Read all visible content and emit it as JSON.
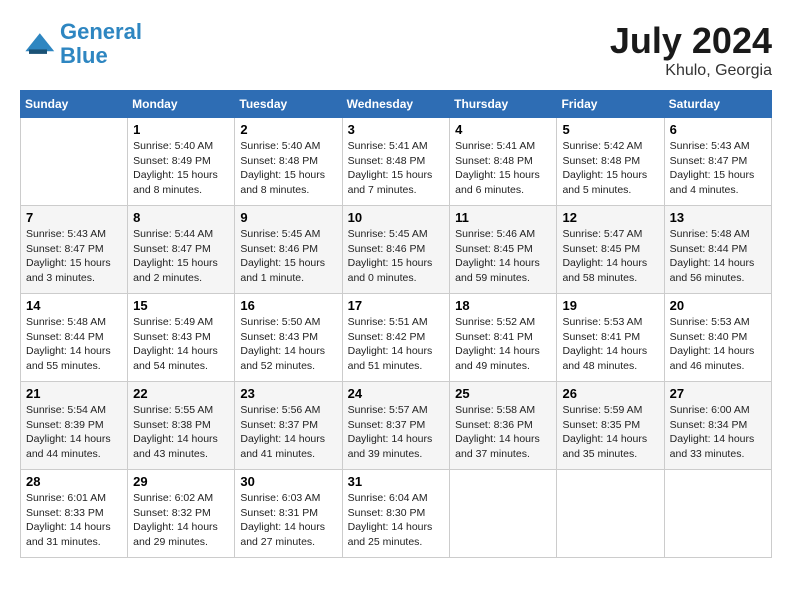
{
  "header": {
    "logo_line1": "General",
    "logo_line2": "Blue",
    "month": "July 2024",
    "location": "Khulo, Georgia"
  },
  "weekdays": [
    "Sunday",
    "Monday",
    "Tuesday",
    "Wednesday",
    "Thursday",
    "Friday",
    "Saturday"
  ],
  "weeks": [
    [
      {
        "day": "",
        "info": ""
      },
      {
        "day": "1",
        "info": "Sunrise: 5:40 AM\nSunset: 8:49 PM\nDaylight: 15 hours\nand 8 minutes."
      },
      {
        "day": "2",
        "info": "Sunrise: 5:40 AM\nSunset: 8:48 PM\nDaylight: 15 hours\nand 8 minutes."
      },
      {
        "day": "3",
        "info": "Sunrise: 5:41 AM\nSunset: 8:48 PM\nDaylight: 15 hours\nand 7 minutes."
      },
      {
        "day": "4",
        "info": "Sunrise: 5:41 AM\nSunset: 8:48 PM\nDaylight: 15 hours\nand 6 minutes."
      },
      {
        "day": "5",
        "info": "Sunrise: 5:42 AM\nSunset: 8:48 PM\nDaylight: 15 hours\nand 5 minutes."
      },
      {
        "day": "6",
        "info": "Sunrise: 5:43 AM\nSunset: 8:47 PM\nDaylight: 15 hours\nand 4 minutes."
      }
    ],
    [
      {
        "day": "7",
        "info": "Sunrise: 5:43 AM\nSunset: 8:47 PM\nDaylight: 15 hours\nand 3 minutes."
      },
      {
        "day": "8",
        "info": "Sunrise: 5:44 AM\nSunset: 8:47 PM\nDaylight: 15 hours\nand 2 minutes."
      },
      {
        "day": "9",
        "info": "Sunrise: 5:45 AM\nSunset: 8:46 PM\nDaylight: 15 hours\nand 1 minute."
      },
      {
        "day": "10",
        "info": "Sunrise: 5:45 AM\nSunset: 8:46 PM\nDaylight: 15 hours\nand 0 minutes."
      },
      {
        "day": "11",
        "info": "Sunrise: 5:46 AM\nSunset: 8:45 PM\nDaylight: 14 hours\nand 59 minutes."
      },
      {
        "day": "12",
        "info": "Sunrise: 5:47 AM\nSunset: 8:45 PM\nDaylight: 14 hours\nand 58 minutes."
      },
      {
        "day": "13",
        "info": "Sunrise: 5:48 AM\nSunset: 8:44 PM\nDaylight: 14 hours\nand 56 minutes."
      }
    ],
    [
      {
        "day": "14",
        "info": "Sunrise: 5:48 AM\nSunset: 8:44 PM\nDaylight: 14 hours\nand 55 minutes."
      },
      {
        "day": "15",
        "info": "Sunrise: 5:49 AM\nSunset: 8:43 PM\nDaylight: 14 hours\nand 54 minutes."
      },
      {
        "day": "16",
        "info": "Sunrise: 5:50 AM\nSunset: 8:43 PM\nDaylight: 14 hours\nand 52 minutes."
      },
      {
        "day": "17",
        "info": "Sunrise: 5:51 AM\nSunset: 8:42 PM\nDaylight: 14 hours\nand 51 minutes."
      },
      {
        "day": "18",
        "info": "Sunrise: 5:52 AM\nSunset: 8:41 PM\nDaylight: 14 hours\nand 49 minutes."
      },
      {
        "day": "19",
        "info": "Sunrise: 5:53 AM\nSunset: 8:41 PM\nDaylight: 14 hours\nand 48 minutes."
      },
      {
        "day": "20",
        "info": "Sunrise: 5:53 AM\nSunset: 8:40 PM\nDaylight: 14 hours\nand 46 minutes."
      }
    ],
    [
      {
        "day": "21",
        "info": "Sunrise: 5:54 AM\nSunset: 8:39 PM\nDaylight: 14 hours\nand 44 minutes."
      },
      {
        "day": "22",
        "info": "Sunrise: 5:55 AM\nSunset: 8:38 PM\nDaylight: 14 hours\nand 43 minutes."
      },
      {
        "day": "23",
        "info": "Sunrise: 5:56 AM\nSunset: 8:37 PM\nDaylight: 14 hours\nand 41 minutes."
      },
      {
        "day": "24",
        "info": "Sunrise: 5:57 AM\nSunset: 8:37 PM\nDaylight: 14 hours\nand 39 minutes."
      },
      {
        "day": "25",
        "info": "Sunrise: 5:58 AM\nSunset: 8:36 PM\nDaylight: 14 hours\nand 37 minutes."
      },
      {
        "day": "26",
        "info": "Sunrise: 5:59 AM\nSunset: 8:35 PM\nDaylight: 14 hours\nand 35 minutes."
      },
      {
        "day": "27",
        "info": "Sunrise: 6:00 AM\nSunset: 8:34 PM\nDaylight: 14 hours\nand 33 minutes."
      }
    ],
    [
      {
        "day": "28",
        "info": "Sunrise: 6:01 AM\nSunset: 8:33 PM\nDaylight: 14 hours\nand 31 minutes."
      },
      {
        "day": "29",
        "info": "Sunrise: 6:02 AM\nSunset: 8:32 PM\nDaylight: 14 hours\nand 29 minutes."
      },
      {
        "day": "30",
        "info": "Sunrise: 6:03 AM\nSunset: 8:31 PM\nDaylight: 14 hours\nand 27 minutes."
      },
      {
        "day": "31",
        "info": "Sunrise: 6:04 AM\nSunset: 8:30 PM\nDaylight: 14 hours\nand 25 minutes."
      },
      {
        "day": "",
        "info": ""
      },
      {
        "day": "",
        "info": ""
      },
      {
        "day": "",
        "info": ""
      }
    ]
  ]
}
